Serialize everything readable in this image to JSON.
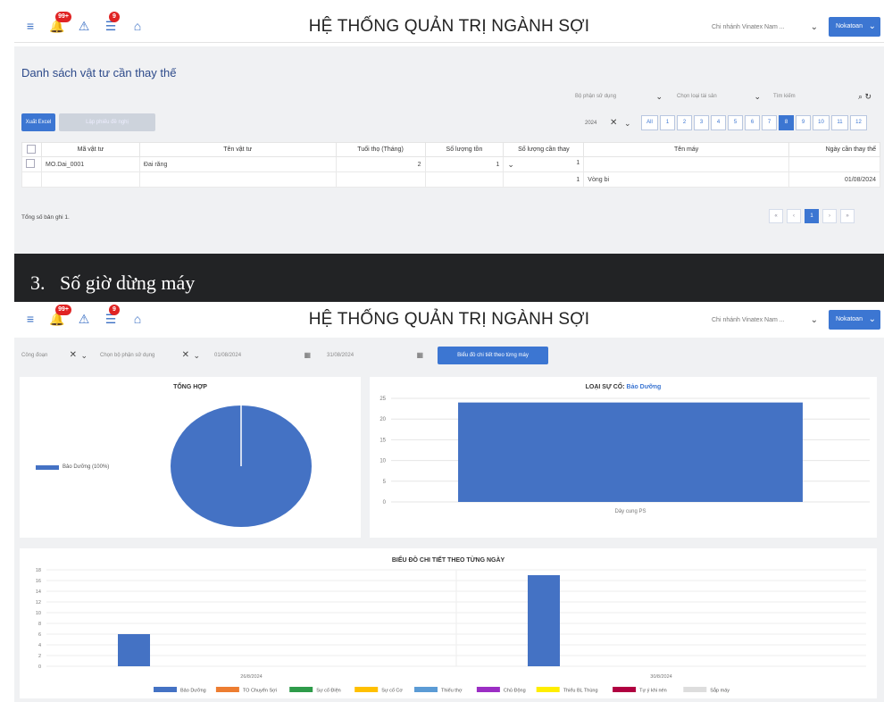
{
  "header1": {
    "title": "HỆ THỐNG QUẢN TRỊ NGÀNH SỢI",
    "branch": "Chi nhánh Vinatex Nam ...",
    "user": "Nokatoan",
    "badges": {
      "notify": "99+",
      "tasks": "9"
    }
  },
  "section1": {
    "page_title": "Danh sách vật tư cần thay thế",
    "filters": {
      "dept": "Bộ phận sử dụng",
      "type": "Chọn loại tài sản",
      "search_placeholder": "Tìm kiếm"
    },
    "export_button": "Xuất Excel",
    "disabled_button": "Lập phiếu đề nghị",
    "year": "2024",
    "months": [
      "All",
      "1",
      "2",
      "3",
      "4",
      "5",
      "6",
      "7",
      "8",
      "9",
      "10",
      "11",
      "12"
    ],
    "active_month": "8",
    "columns": [
      "Mã vật tư",
      "Tên vật tư",
      "Tuổi thọ (Tháng)",
      "Số lượng tồn",
      "Số lượng cần thay",
      "Tên máy",
      "Ngày cần thay thế"
    ],
    "rows": [
      {
        "code": "MO.Dai_0001",
        "name": "Đai răng",
        "life": "2",
        "stock": "1",
        "need": "1",
        "machine": "",
        "date": ""
      },
      {
        "code": "",
        "name": "",
        "life": "",
        "stock": "",
        "need": "1",
        "machine": "Vòng bi",
        "date": "01/08/2024"
      }
    ],
    "total_text": "Tổng số bản ghi 1.",
    "pager": [
      "«",
      "‹",
      "1",
      "›",
      "»"
    ],
    "active_page": "1"
  },
  "banner": {
    "number": "3.",
    "text": "Số giờ dừng máy"
  },
  "header2": {
    "title": "HỆ THỐNG QUẢN TRỊ NGÀNH SỢI",
    "branch": "Chi nhánh Vinatex Nam ...",
    "user": "Nokatoan",
    "badges": {
      "notify": "99+",
      "tasks": "9"
    }
  },
  "section2": {
    "filters": {
      "stage": "Công đoạn",
      "dept": "Chọn bộ phận sử dụng",
      "from": "01/08/2024",
      "to": "31/08/2024"
    },
    "detail_button": "Biểu đồ chi tiết theo từng máy",
    "colors": {
      "blue": "#4472c4",
      "orange": "#ed7d31",
      "green": "#2e9b4a",
      "yellow": "#ffc000",
      "lightblue": "#5b9bd5",
      "purple": "#9b2ec4",
      "lime": "#ffee00",
      "crimson": "#b00040",
      "gray": "#dddddd"
    }
  },
  "chart_data": [
    {
      "type": "pie",
      "title": "TỔNG HỢP",
      "labels": [
        "Bảo Dưỡng (100%)"
      ],
      "values": [
        100
      ],
      "legend": "left"
    },
    {
      "type": "bar",
      "title": "LOẠI SỰ CỐ:",
      "title_highlight": "Bảo Dưỡng",
      "categories": [
        "Dây cung PS"
      ],
      "values": [
        24
      ],
      "ylim": [
        0,
        25
      ],
      "yticks": [
        0,
        5,
        10,
        15,
        20,
        25
      ],
      "grid": true
    },
    {
      "type": "bar",
      "title": "BIỂU ĐỒ CHI TIẾT THEO TỪNG NGÀY",
      "categories": [
        "26/8/2024",
        "30/8/2024"
      ],
      "series": [
        {
          "name": "Bảo Dưỡng",
          "values": [
            6,
            17
          ]
        },
        {
          "name": "TO Chuyển Sợi",
          "values": [
            0,
            0
          ]
        },
        {
          "name": "Sự cố Điện",
          "values": [
            0,
            0
          ]
        },
        {
          "name": "Sự cố Cơ",
          "values": [
            0,
            0
          ]
        },
        {
          "name": "Thiếu thợ",
          "values": [
            0,
            0
          ]
        },
        {
          "name": "Chủ Động",
          "values": [
            0,
            0
          ]
        },
        {
          "name": "Thiếu BL Thùng",
          "values": [
            0,
            0
          ]
        },
        {
          "name": "Tự ý khi nén",
          "values": [
            0,
            0
          ]
        },
        {
          "name": "Sắp máy",
          "values": [
            0,
            0
          ]
        }
      ],
      "ylim": [
        0,
        18
      ],
      "yticks": [
        0,
        2,
        4,
        6,
        8,
        10,
        12,
        14,
        16,
        18
      ],
      "legend": "bottom",
      "grid": true
    }
  ]
}
